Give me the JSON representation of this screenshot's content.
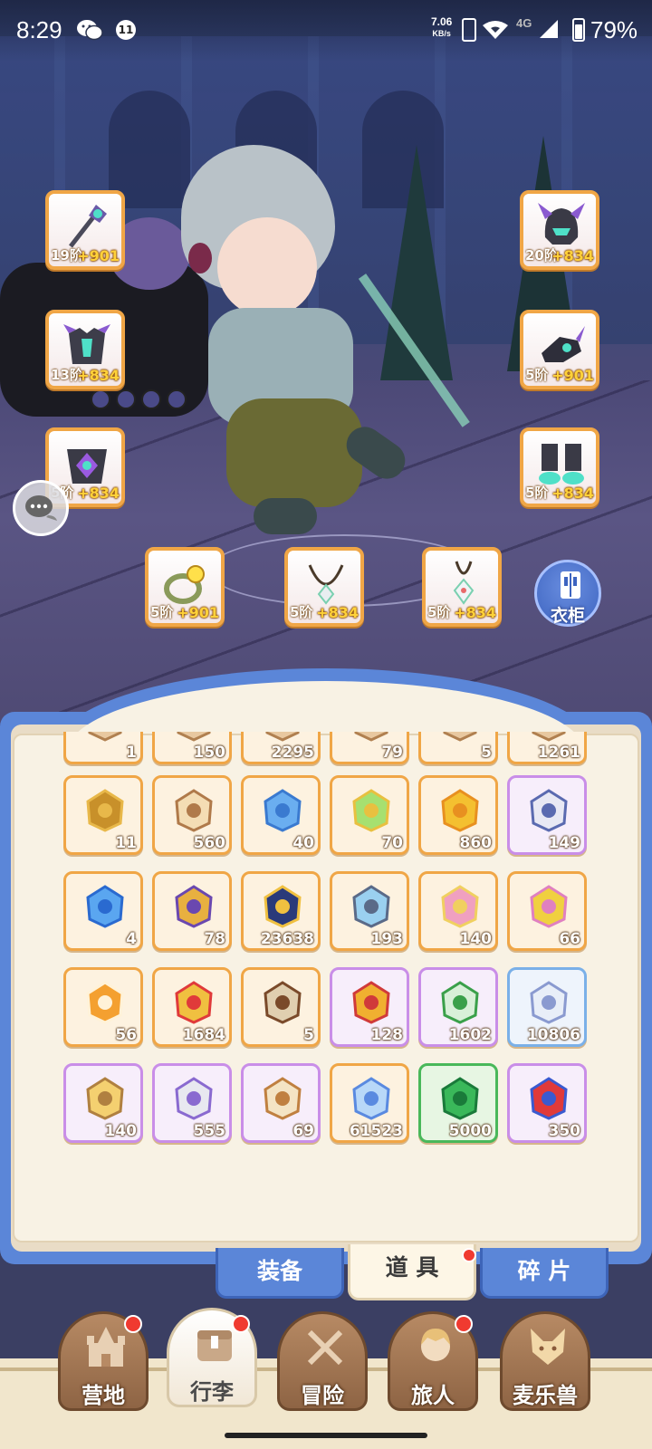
{
  "status_bar": {
    "time": "8:29",
    "notification_count": "11",
    "net_speed_value": "7.06",
    "net_speed_unit": "KB/s",
    "network_type": "4G",
    "battery": "79%"
  },
  "equipment": [
    {
      "id": "weapon",
      "tier": "19阶",
      "bonus": "+901",
      "icon": "staff-icon"
    },
    {
      "id": "armor",
      "tier": "13阶",
      "bonus": "+834",
      "icon": "armor-icon"
    },
    {
      "id": "belt",
      "tier": "5阶",
      "bonus": "+834",
      "icon": "belt-icon"
    },
    {
      "id": "helmet",
      "tier": "20阶",
      "bonus": "+834",
      "icon": "helmet-icon"
    },
    {
      "id": "gloves",
      "tier": "5阶",
      "bonus": "+901",
      "icon": "gauntlet-icon"
    },
    {
      "id": "boots",
      "tier": "5阶",
      "bonus": "+834",
      "icon": "boots-icon"
    },
    {
      "id": "ring",
      "tier": "5阶",
      "bonus": "+901",
      "icon": "ring-icon"
    },
    {
      "id": "necklace",
      "tier": "5阶",
      "bonus": "+834",
      "icon": "necklace-icon"
    },
    {
      "id": "amulet",
      "tier": "5阶",
      "bonus": "+834",
      "icon": "amulet-icon"
    }
  ],
  "wardrobe_label": "衣柜",
  "inventory_items": [
    {
      "qty": "1",
      "rarity": "orange",
      "icon": "item-icon"
    },
    {
      "qty": "150",
      "rarity": "orange",
      "icon": "item-icon"
    },
    {
      "qty": "2295",
      "rarity": "orange",
      "icon": "item-icon"
    },
    {
      "qty": "79",
      "rarity": "orange",
      "icon": "item-icon"
    },
    {
      "qty": "5",
      "rarity": "orange",
      "icon": "item-icon"
    },
    {
      "qty": "1261",
      "rarity": "orange",
      "icon": "item-icon"
    },
    {
      "qty": "11",
      "rarity": "orange",
      "icon": "cat-stamp-icon"
    },
    {
      "qty": "560",
      "rarity": "orange",
      "icon": "cake-icon"
    },
    {
      "qty": "40",
      "rarity": "orange",
      "icon": "paper-plane-icon"
    },
    {
      "qty": "70",
      "rarity": "orange",
      "icon": "crystal-tile-icon"
    },
    {
      "qty": "860",
      "rarity": "orange",
      "icon": "star-cat-icon"
    },
    {
      "qty": "149",
      "rarity": "purple",
      "icon": "pearl-icon"
    },
    {
      "qty": "4",
      "rarity": "orange",
      "icon": "potion-icon"
    },
    {
      "qty": "78",
      "rarity": "orange",
      "icon": "bell-icon"
    },
    {
      "qty": "23638",
      "rarity": "orange",
      "icon": "orb-icon"
    },
    {
      "qty": "193",
      "rarity": "orange",
      "icon": "ice-crystal-icon"
    },
    {
      "qty": "140",
      "rarity": "orange",
      "icon": "rainbow-paint-icon"
    },
    {
      "qty": "66",
      "rarity": "orange",
      "icon": "paint-splash-icon"
    },
    {
      "qty": "56",
      "rarity": "orange",
      "icon": "card-icon"
    },
    {
      "qty": "1684",
      "rarity": "orange",
      "icon": "jingle-bell-icon"
    },
    {
      "qty": "5",
      "rarity": "orange",
      "icon": "seed-bag-icon"
    },
    {
      "qty": "128",
      "rarity": "purple",
      "icon": "horseshoe-icon"
    },
    {
      "qty": "1602",
      "rarity": "purple",
      "icon": "bottle-icon"
    },
    {
      "qty": "10806",
      "rarity": "blue",
      "icon": "ore-pile-icon"
    },
    {
      "qty": "140",
      "rarity": "purple",
      "icon": "bread-icon"
    },
    {
      "qty": "555",
      "rarity": "purple",
      "icon": "spoon-icon"
    },
    {
      "qty": "69",
      "rarity": "purple",
      "icon": "flour-bag-icon"
    },
    {
      "qty": "61523",
      "rarity": "orange",
      "icon": "star-crystal-icon"
    },
    {
      "qty": "5000",
      "rarity": "green",
      "icon": "emerald-icon"
    },
    {
      "qty": "350",
      "rarity": "purple",
      "icon": "magnet-icon"
    }
  ],
  "tabs": [
    {
      "label": "装备",
      "active": false
    },
    {
      "label": "道 具",
      "active": true
    },
    {
      "label": "碎 片",
      "active": false
    }
  ],
  "nav": [
    {
      "label": "营地",
      "icon": "castle-icon",
      "badge": true
    },
    {
      "label": "行李",
      "icon": "chest-icon",
      "badge": true,
      "active": true
    },
    {
      "label": "冒险",
      "icon": "crossed-swords-icon",
      "badge": false
    },
    {
      "label": "旅人",
      "icon": "character-icon",
      "badge": true
    },
    {
      "label": "麦乐兽",
      "icon": "fox-icon",
      "badge": false
    }
  ],
  "colors": {
    "frame_blue": "#5b86d8",
    "rarity_orange": "#f0a646",
    "rarity_purple": "#c98ee8",
    "rarity_green": "#49b85a",
    "rarity_blue": "#7ab0e8",
    "badge_red": "#f03a30"
  }
}
